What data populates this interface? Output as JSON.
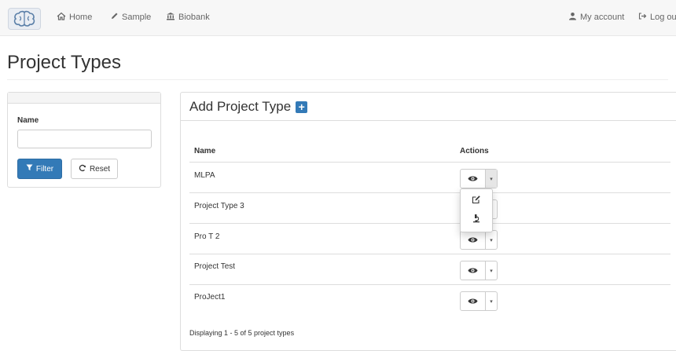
{
  "navbar": {
    "logo_icon": "brain-icon",
    "items": [
      {
        "label": "Home",
        "icon": "home-icon"
      },
      {
        "label": "Sample",
        "icon": "pencil-icon"
      },
      {
        "label": "Biobank",
        "icon": "bank-icon"
      }
    ],
    "right_items": [
      {
        "label": "My account",
        "icon": "user-icon"
      },
      {
        "label": "Log out",
        "icon": "logout-icon"
      }
    ]
  },
  "page": {
    "title": "Project Types"
  },
  "filter": {
    "name_label": "Name",
    "name_value": "",
    "filter_button": "Filter",
    "reset_button": "Reset"
  },
  "main": {
    "title": "Add Project Type",
    "add_icon": "plus-square-icon",
    "columns": [
      "Name",
      "Actions"
    ],
    "rows": [
      {
        "name": "MLPA"
      },
      {
        "name": "Project Type 3"
      },
      {
        "name": "Pro T 2"
      },
      {
        "name": "Project Test"
      },
      {
        "name": "ProJect1"
      }
    ],
    "footer": "Displaying 1 - 5 of 5 project types",
    "dropdown_icons": [
      "edit-icon",
      "microscope-icon"
    ]
  },
  "colors": {
    "primary": "#337ab7",
    "navbar_bg": "#f7f7f7",
    "border": "#dddddd"
  }
}
